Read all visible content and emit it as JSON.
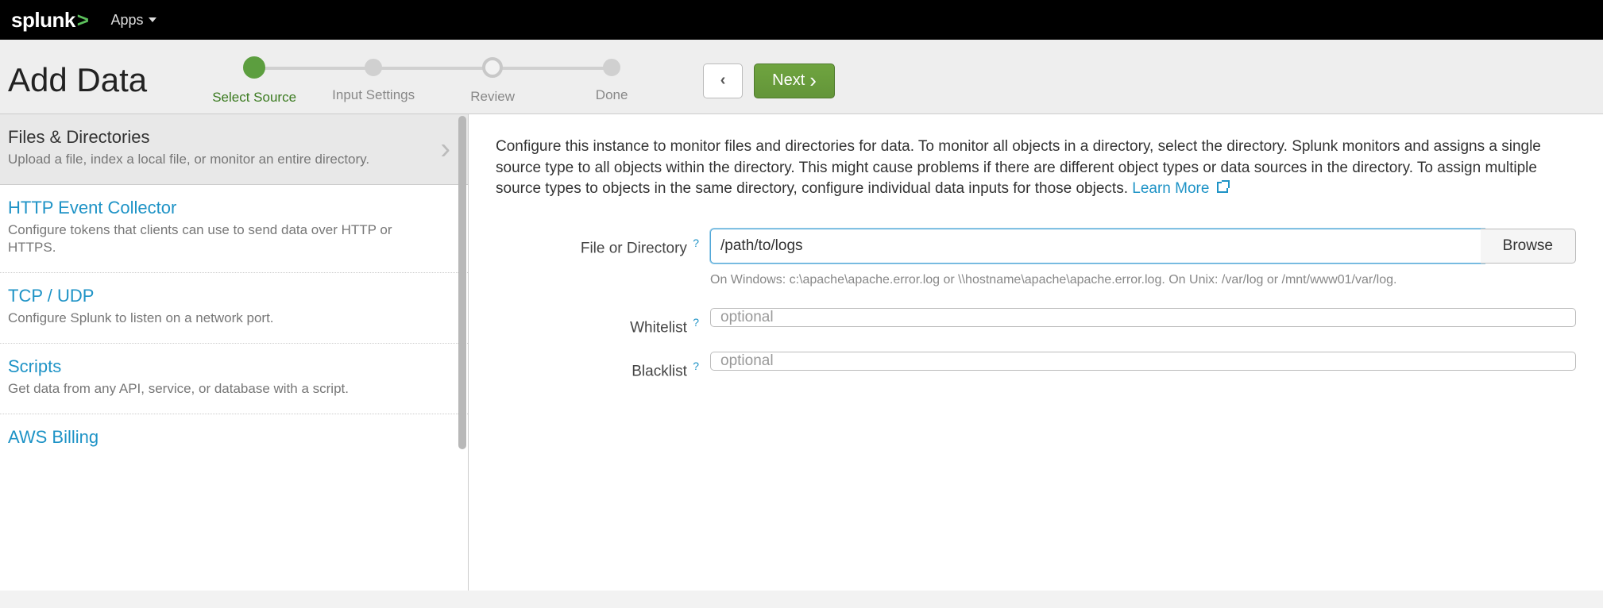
{
  "nav": {
    "apps_label": "Apps"
  },
  "header": {
    "title": "Add Data",
    "steps": [
      "Select Source",
      "Input Settings",
      "Review",
      "Done"
    ],
    "active_step": 0,
    "next_label": "Next"
  },
  "sidebar": [
    {
      "title": "Files & Directories",
      "desc": "Upload a file, index a local file, or monitor an entire directory.",
      "selected": true
    },
    {
      "title": "HTTP Event Collector",
      "desc": "Configure tokens that clients can use to send data over HTTP or HTTPS."
    },
    {
      "title": "TCP / UDP",
      "desc": "Configure Splunk to listen on a network port."
    },
    {
      "title": "Scripts",
      "desc": "Get data from any API, service, or database with a script."
    },
    {
      "title": "AWS Billing",
      "desc": ""
    }
  ],
  "main": {
    "description": "Configure this instance to monitor files and directories for data. To monitor all objects in a directory, select the directory. Splunk monitors and assigns a single source type to all objects within the directory. This might cause problems if there are different object types or data sources in the directory. To assign multiple source types to objects in the same directory, configure individual data inputs for those objects.",
    "learn_more": "Learn More",
    "fields": {
      "file_dir": {
        "label": "File or Directory",
        "value": "/path/to/logs",
        "browse": "Browse",
        "hint": "On Windows: c:\\apache\\apache.error.log or \\\\hostname\\apache\\apache.error.log. On Unix: /var/log or /mnt/www01/var/log."
      },
      "whitelist": {
        "label": "Whitelist",
        "placeholder": "optional"
      },
      "blacklist": {
        "label": "Blacklist",
        "placeholder": "optional"
      }
    }
  }
}
